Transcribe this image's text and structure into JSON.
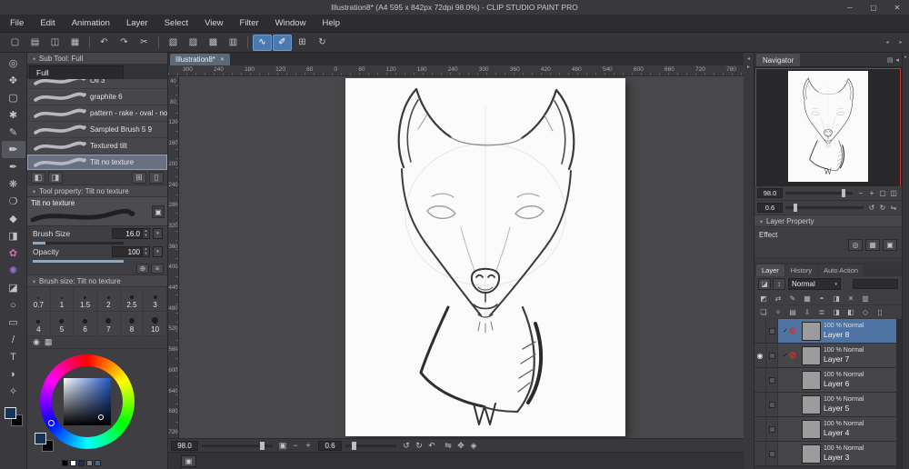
{
  "colors": {
    "accent_blue": "#4c79b0",
    "selection_blue": "#4f74a3",
    "tab_blue": "#5b6878",
    "tool_pink": "#d667b5",
    "tool_purple": "#9a6ad8",
    "warning_red": "#d23030",
    "navigator_view_red": "#c53030",
    "main_color": "#16335e",
    "canvas_white": "#fbfbfb",
    "history": [
      "#000000",
      "#ffffff",
      "#16335e",
      "#808080",
      "#3a66a8"
    ]
  },
  "window": {
    "title": "Illustration8* (A4 595 x 842px 72dpi 98.0%) - CLIP STUDIO PAINT PRO",
    "controls": [
      {
        "name": "minimize-button",
        "glyph": "─"
      },
      {
        "name": "maximize-button",
        "glyph": "▢"
      },
      {
        "name": "close-button",
        "glyph": "✕"
      }
    ]
  },
  "menu": {
    "items": [
      {
        "name": "menu-file",
        "label": "File"
      },
      {
        "name": "menu-edit",
        "label": "Edit"
      },
      {
        "name": "menu-animation",
        "label": "Animation"
      },
      {
        "name": "menu-layer",
        "label": "Layer"
      },
      {
        "name": "menu-select",
        "label": "Select"
      },
      {
        "name": "menu-view",
        "label": "View"
      },
      {
        "name": "menu-filter",
        "label": "Filter"
      },
      {
        "name": "menu-window",
        "label": "Window"
      },
      {
        "name": "menu-help",
        "label": "Help"
      }
    ]
  },
  "toolbar": {
    "buttons": [
      {
        "name": "new-file-button",
        "glyph": "▢"
      },
      {
        "name": "open-file-button",
        "glyph": "▤"
      },
      {
        "name": "save-button",
        "glyph": "◫"
      },
      {
        "name": "print-button",
        "glyph": "▦"
      },
      {
        "name": "separator",
        "sep": true
      },
      {
        "name": "undo-button",
        "glyph": "↶"
      },
      {
        "name": "redo-button",
        "glyph": "↷"
      },
      {
        "name": "clear-button",
        "glyph": "✂"
      },
      {
        "name": "separator",
        "sep": true
      },
      {
        "name": "select-rectangle-button",
        "glyph": "▧"
      },
      {
        "name": "deselect-button",
        "glyph": "▨"
      },
      {
        "name": "invert-selection-button",
        "glyph": "▩"
      },
      {
        "name": "selection-border-button",
        "glyph": "▥"
      },
      {
        "name": "separator",
        "sep": true
      },
      {
        "name": "snap-to-ruler-button",
        "glyph": "∿",
        "active": true
      },
      {
        "name": "snap-to-special-ruler-button",
        "glyph": "✐",
        "active": true
      },
      {
        "name": "grid-button",
        "glyph": "⊞"
      },
      {
        "name": "rotate-view-button",
        "glyph": "↻"
      }
    ],
    "end_icons": [
      {
        "name": "collapse-panels-left-icon",
        "glyph": "◂"
      },
      {
        "name": "collapse-panels-right-icon",
        "glyph": "▸"
      }
    ]
  },
  "toolstrip": {
    "tools": [
      {
        "name": "zoom-tool",
        "glyph": "◎"
      },
      {
        "name": "move-tool",
        "glyph": "✥"
      },
      {
        "name": "selection-tool",
        "glyph": "▢"
      },
      {
        "name": "auto-select-tool",
        "glyph": "✱"
      },
      {
        "name": "pen-tool",
        "glyph": "✎"
      },
      {
        "name": "pencil-tool",
        "glyph": "✏",
        "active": true
      },
      {
        "name": "brush-tool",
        "glyph": "✒"
      },
      {
        "name": "airbrush-tool",
        "glyph": "❋"
      },
      {
        "name": "blend-tool",
        "glyph": "❍"
      },
      {
        "name": "fill-tool",
        "glyph": "◆"
      },
      {
        "name": "gradient-tool",
        "glyph": "◨"
      },
      {
        "name": "decoration-tool",
        "glyph": "✿",
        "pink": true
      },
      {
        "name": "decoration-tool-2",
        "glyph": "✺",
        "purple": true
      },
      {
        "name": "eraser-tool",
        "glyph": "◪"
      },
      {
        "name": "figure-tool",
        "glyph": "○"
      },
      {
        "name": "frame-border-tool",
        "glyph": "▭"
      },
      {
        "name": "ruler-tool",
        "glyph": "/"
      },
      {
        "name": "text-tool",
        "glyph": "T"
      },
      {
        "name": "balloon-tool",
        "glyph": "◗"
      },
      {
        "name": "eyedropper-tool",
        "glyph": "✧"
      }
    ]
  },
  "subtool": {
    "title": "Sub Tool: Full",
    "tab": "Full",
    "brushes": [
      {
        "label": "Oil 3"
      },
      {
        "label": "graphite 6"
      },
      {
        "label": "pattern - rake - oval - no texture"
      },
      {
        "label": "Sampled Brush 5 9"
      },
      {
        "label": "Textured tilt"
      },
      {
        "label": "Tilt no texture",
        "selected": true
      }
    ],
    "footer_icons": [
      {
        "name": "show-as-list-button",
        "glyph": "◧"
      },
      {
        "name": "show-as-tile-button",
        "glyph": "◨"
      },
      {
        "name": "add-subtool-button",
        "glyph": "⊞"
      },
      {
        "name": "delete-subtool-button",
        "glyph": "▯"
      }
    ]
  },
  "tool_property": {
    "title": "Tool property: Tilt no texture",
    "preview_label": "Tilt no texture",
    "rows": [
      {
        "label": "Brush Size",
        "value": "16.0",
        "low": true
      },
      {
        "label": "Opacity",
        "value": "100",
        "full": true
      }
    ],
    "footer_icons": [
      {
        "name": "register-settings-button",
        "glyph": "⊕"
      },
      {
        "name": "show-detail-palette-button",
        "glyph": "≡"
      }
    ]
  },
  "brush_size_panel": {
    "title": "Brush size: Tilt no texture",
    "sizes": [
      "0.7",
      "1",
      "1.5",
      "2",
      "2.5",
      "3",
      "4",
      "5",
      "6",
      "7",
      "8",
      "10"
    ]
  },
  "color_wheel": {
    "icons": [
      {
        "name": "color-wheel-tab-icon",
        "glyph": "◉"
      },
      {
        "name": "color-set-tab-icon",
        "glyph": "▦"
      }
    ]
  },
  "canvas": {
    "tab": "Illustration8*",
    "ruler_top": [
      "300",
      "240",
      "180",
      "120",
      "60",
      "0",
      "60",
      "120",
      "180",
      "240",
      "300",
      "360",
      "420",
      "480",
      "540",
      "600",
      "660",
      "720",
      "780"
    ],
    "ruler_left": [
      "40",
      "80",
      "120",
      "160",
      "200",
      "240",
      "280",
      "320",
      "360",
      "400",
      "440",
      "480",
      "520",
      "560",
      "600",
      "640",
      "680",
      "720"
    ],
    "zoom": "98.0",
    "rotation": "0.6",
    "zoom_buttons": [
      {
        "name": "fit-to-screen-button",
        "glyph": "▣"
      },
      {
        "name": "zoom-out-button",
        "glyph": "−"
      },
      {
        "name": "zoom-in-button",
        "glyph": "+"
      }
    ],
    "rot_buttons": [
      {
        "name": "rotate-left-button",
        "glyph": "↺"
      },
      {
        "name": "rotate-right-button",
        "glyph": "↻"
      },
      {
        "name": "reset-rotation-button",
        "glyph": "↶"
      }
    ],
    "extra_buttons": [
      {
        "name": "flip-view-button",
        "glyph": "⇋"
      },
      {
        "name": "pan-view-button",
        "glyph": "✥"
      },
      {
        "name": "subview-button",
        "glyph": "◈"
      }
    ],
    "bottom_buttons": [
      {
        "name": "timeline-button",
        "glyph": "▣"
      }
    ]
  },
  "navigator": {
    "title": "Navigator",
    "header_icons": [
      {
        "name": "panel-menu-icon",
        "glyph": "▤"
      },
      {
        "name": "panel-collapse-icon",
        "glyph": "◂"
      }
    ],
    "zoom": "98.0",
    "rotation": "0.6",
    "zoom_buttons": [
      {
        "name": "nav-zoom-out-button",
        "glyph": "−"
      },
      {
        "name": "nav-zoom-in-button",
        "glyph": "+"
      },
      {
        "name": "nav-fit-button",
        "glyph": "▢"
      },
      {
        "name": "nav-actual-size-button",
        "glyph": "◫"
      }
    ],
    "rot_buttons": [
      {
        "name": "nav-rotate-left-button",
        "glyph": "↺"
      },
      {
        "name": "nav-rotate-right-button",
        "glyph": "↻"
      },
      {
        "name": "nav-flip-button",
        "glyph": "⇋"
      }
    ]
  },
  "layer_property": {
    "title": "Layer Property",
    "effect_label": "Effect",
    "effect_icons": [
      {
        "name": "border-effect-button",
        "glyph": "◎"
      },
      {
        "name": "tone-effect-button",
        "glyph": "▦"
      },
      {
        "name": "expression-color-button",
        "glyph": "▣"
      }
    ]
  },
  "layers": {
    "tabs": [
      {
        "name": "tab-layer",
        "label": "Layer",
        "active": true
      },
      {
        "name": "tab-history",
        "label": "History"
      },
      {
        "name": "tab-auto-action",
        "label": "Auto Action"
      }
    ],
    "blend_mode": "Normal",
    "blend_icons": [
      {
        "name": "layer-filter-icon",
        "glyph": "◪"
      },
      {
        "name": "layer-order-icon",
        "glyph": "↕"
      }
    ],
    "lock_icons": [
      {
        "name": "clip-to-layer-below-button",
        "glyph": "◩"
      },
      {
        "name": "flip-layer-button",
        "glyph": "⇄"
      },
      {
        "name": "draft-layer-button",
        "glyph": "✎"
      },
      {
        "name": "lock-layer-button",
        "glyph": "▦"
      },
      {
        "name": "lock-transparent-pixels-button",
        "glyph": "◓"
      },
      {
        "name": "enable-mask-button",
        "glyph": "◨"
      },
      {
        "name": "delete-mask-button",
        "glyph": "✕"
      },
      {
        "name": "ruler-range-button",
        "glyph": "▥"
      }
    ],
    "action_icons": [
      {
        "name": "new-raster-layer-button",
        "glyph": "❏"
      },
      {
        "name": "new-vector-layer-button",
        "glyph": "✧"
      },
      {
        "name": "new-folder-button",
        "glyph": "▤"
      },
      {
        "name": "transfer-down-button",
        "glyph": "⇩"
      },
      {
        "name": "merge-down-button",
        "glyph": "≣"
      },
      {
        "name": "create-mask-button",
        "glyph": "◨"
      },
      {
        "name": "apply-mask-button",
        "glyph": "◧"
      },
      {
        "name": "register-material-button",
        "glyph": "◇"
      },
      {
        "name": "delete-layer-button",
        "glyph": "▯"
      }
    ],
    "items": [
      {
        "info": "100 % Normal",
        "label": "Layer 8",
        "selected": true,
        "marks": true
      },
      {
        "info": "100 % Normal",
        "label": "Layer 7",
        "marks": true,
        "eye": true
      },
      {
        "info": "100 % Normal",
        "label": "Layer 6"
      },
      {
        "info": "100 % Normal",
        "label": "Layer 5"
      },
      {
        "info": "100 % Normal",
        "label": "Layer 4"
      },
      {
        "info": "100 % Normal",
        "label": "Layer 3"
      }
    ]
  }
}
